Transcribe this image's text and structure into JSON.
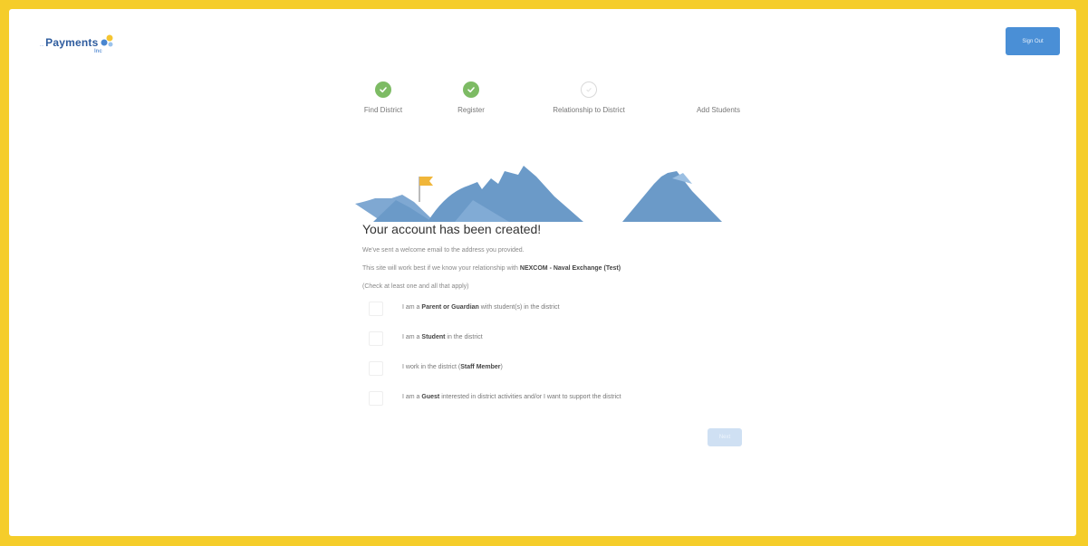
{
  "brand": {
    "name": "Payments",
    "pre_text": "...",
    "sub_text": "Inc"
  },
  "header": {
    "signout_label": "Sign Out"
  },
  "steps": [
    {
      "label": "Find District",
      "status": "done"
    },
    {
      "label": "Register",
      "status": "done"
    },
    {
      "label": "Relationship to District",
      "status": "current"
    },
    {
      "label": "Add Students",
      "status": "upcoming"
    }
  ],
  "main": {
    "title": "Your account has been created!",
    "welcome": "We've sent a welcome email to the address you provided.",
    "relationship_prefix": "This site will work best if we know your relationship with ",
    "district_name": "NEXCOM - Naval Exchange (Test)",
    "check_hint": "(Check at least one and all that apply)",
    "options": [
      {
        "pre": "I am a ",
        "bold": "Parent or Guardian",
        "post": " with student(s) in the district",
        "checked": false
      },
      {
        "pre": "I am a ",
        "bold": "Student",
        "post": " in the district",
        "checked": false
      },
      {
        "pre": "I work in the district (",
        "bold": "Staff Member",
        "post": ")",
        "checked": false
      },
      {
        "pre": "I am a ",
        "bold": "Guest",
        "post": " interested in district activities and/or I want to support the district",
        "checked": false
      }
    ],
    "next_label": "Next"
  },
  "colors": {
    "frame": "#f5cd2a",
    "primary": "#4a8fd6",
    "step_done": "#7dbb64",
    "mountain": "#6b9ac8",
    "flag": "#f0b63a"
  },
  "icons": {
    "step_done": "check-icon",
    "flag": "flag-icon"
  }
}
